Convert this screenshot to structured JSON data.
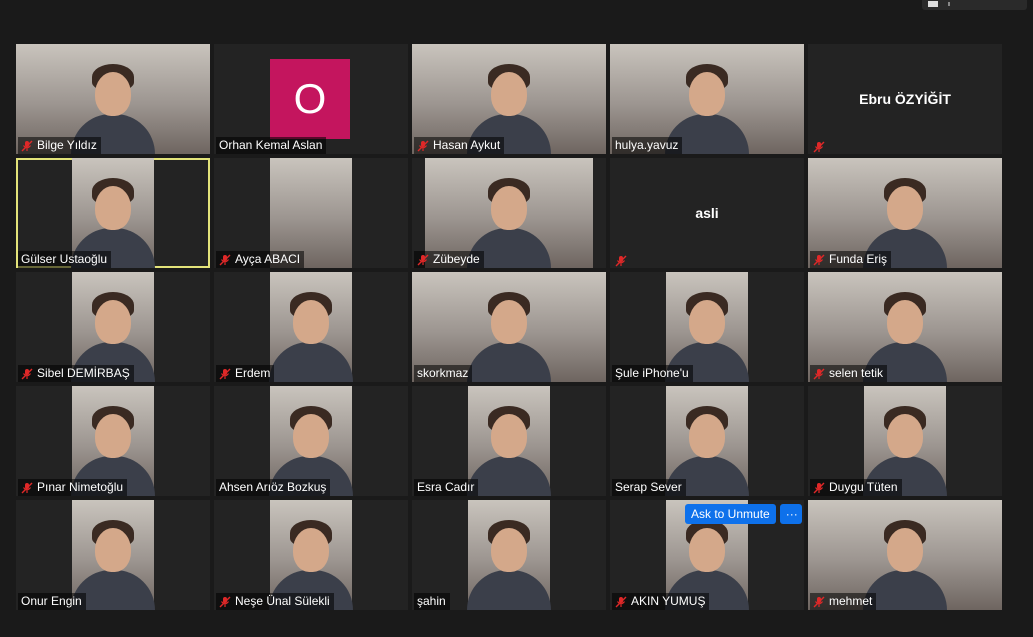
{
  "participants": [
    {
      "name": "Bilge Yıldız",
      "muted": true,
      "video": "girl",
      "vw": 194
    },
    {
      "name": "Orhan Kemal Aslan",
      "muted": false,
      "video": "avatar",
      "avatar": "O"
    },
    {
      "name": "Hasan Aykut",
      "muted": true,
      "video": "man",
      "vw": 194
    },
    {
      "name": "hulya.yavuz",
      "muted": false,
      "video": "woman",
      "vw": 194
    },
    {
      "name": "Ebru ÖZYİĞİT",
      "muted": true,
      "video": "none",
      "show_center": true
    },
    {
      "name": "Gülser Ustaoğlu",
      "muted": false,
      "video": "woman",
      "vw": 82,
      "active": true
    },
    {
      "name": "Ayça ABACI",
      "muted": true,
      "video": "wall",
      "vw": 82
    },
    {
      "name": "Zübeyde",
      "muted": true,
      "video": "woman",
      "vw": 168
    },
    {
      "name": "",
      "muted": true,
      "video": "none",
      "show_center": true,
      "center": "asli"
    },
    {
      "name": "Funda Eriş",
      "muted": true,
      "video": "woman",
      "vw": 194
    },
    {
      "name": "Sibel DEMİRBAŞ",
      "muted": true,
      "video": "woman",
      "vw": 82
    },
    {
      "name": "Erdem",
      "muted": true,
      "video": "man",
      "vw": 82
    },
    {
      "name": "skorkmaz",
      "muted": false,
      "video": "woman",
      "vw": 194
    },
    {
      "name": "Şule iPhone'u",
      "muted": false,
      "video": "woman",
      "vw": 82
    },
    {
      "name": "selen tetik",
      "muted": true,
      "video": "woman",
      "vw": 194
    },
    {
      "name": "Pınar Nimetoğlu",
      "muted": true,
      "video": "woman",
      "vw": 82
    },
    {
      "name": "Ahsen Arıöz Bozkuş",
      "muted": false,
      "video": "woman",
      "vw": 82
    },
    {
      "name": "Esra Cadır",
      "muted": false,
      "video": "woman",
      "vw": 82
    },
    {
      "name": "Serap Sever",
      "muted": false,
      "video": "woman",
      "vw": 82
    },
    {
      "name": "Duygu Tüten",
      "muted": true,
      "video": "woman",
      "vw": 82
    },
    {
      "name": "Onur Engin",
      "muted": false,
      "video": "man",
      "vw": 82
    },
    {
      "name": "Neşe Ünal Sülekli",
      "muted": true,
      "video": "woman",
      "vw": 82
    },
    {
      "name": "şahin",
      "muted": false,
      "video": "man",
      "vw": 82
    },
    {
      "name": "AKIN YUMUŞ",
      "muted": true,
      "video": "man",
      "vw": 82
    },
    {
      "name": "mehmet",
      "muted": true,
      "video": "man",
      "vw": 194
    }
  ],
  "centers": {
    "Ebru ÖZYİĞİT": "Ebru ÖZYİĞİT"
  },
  "unmute": {
    "label": "Ask to Unmute",
    "more": "···"
  },
  "colors": {
    "mute_red": "#e02828",
    "active_border": "#e3e37a",
    "button_blue": "#0e71eb",
    "avatar_bg": "#c4155e"
  }
}
